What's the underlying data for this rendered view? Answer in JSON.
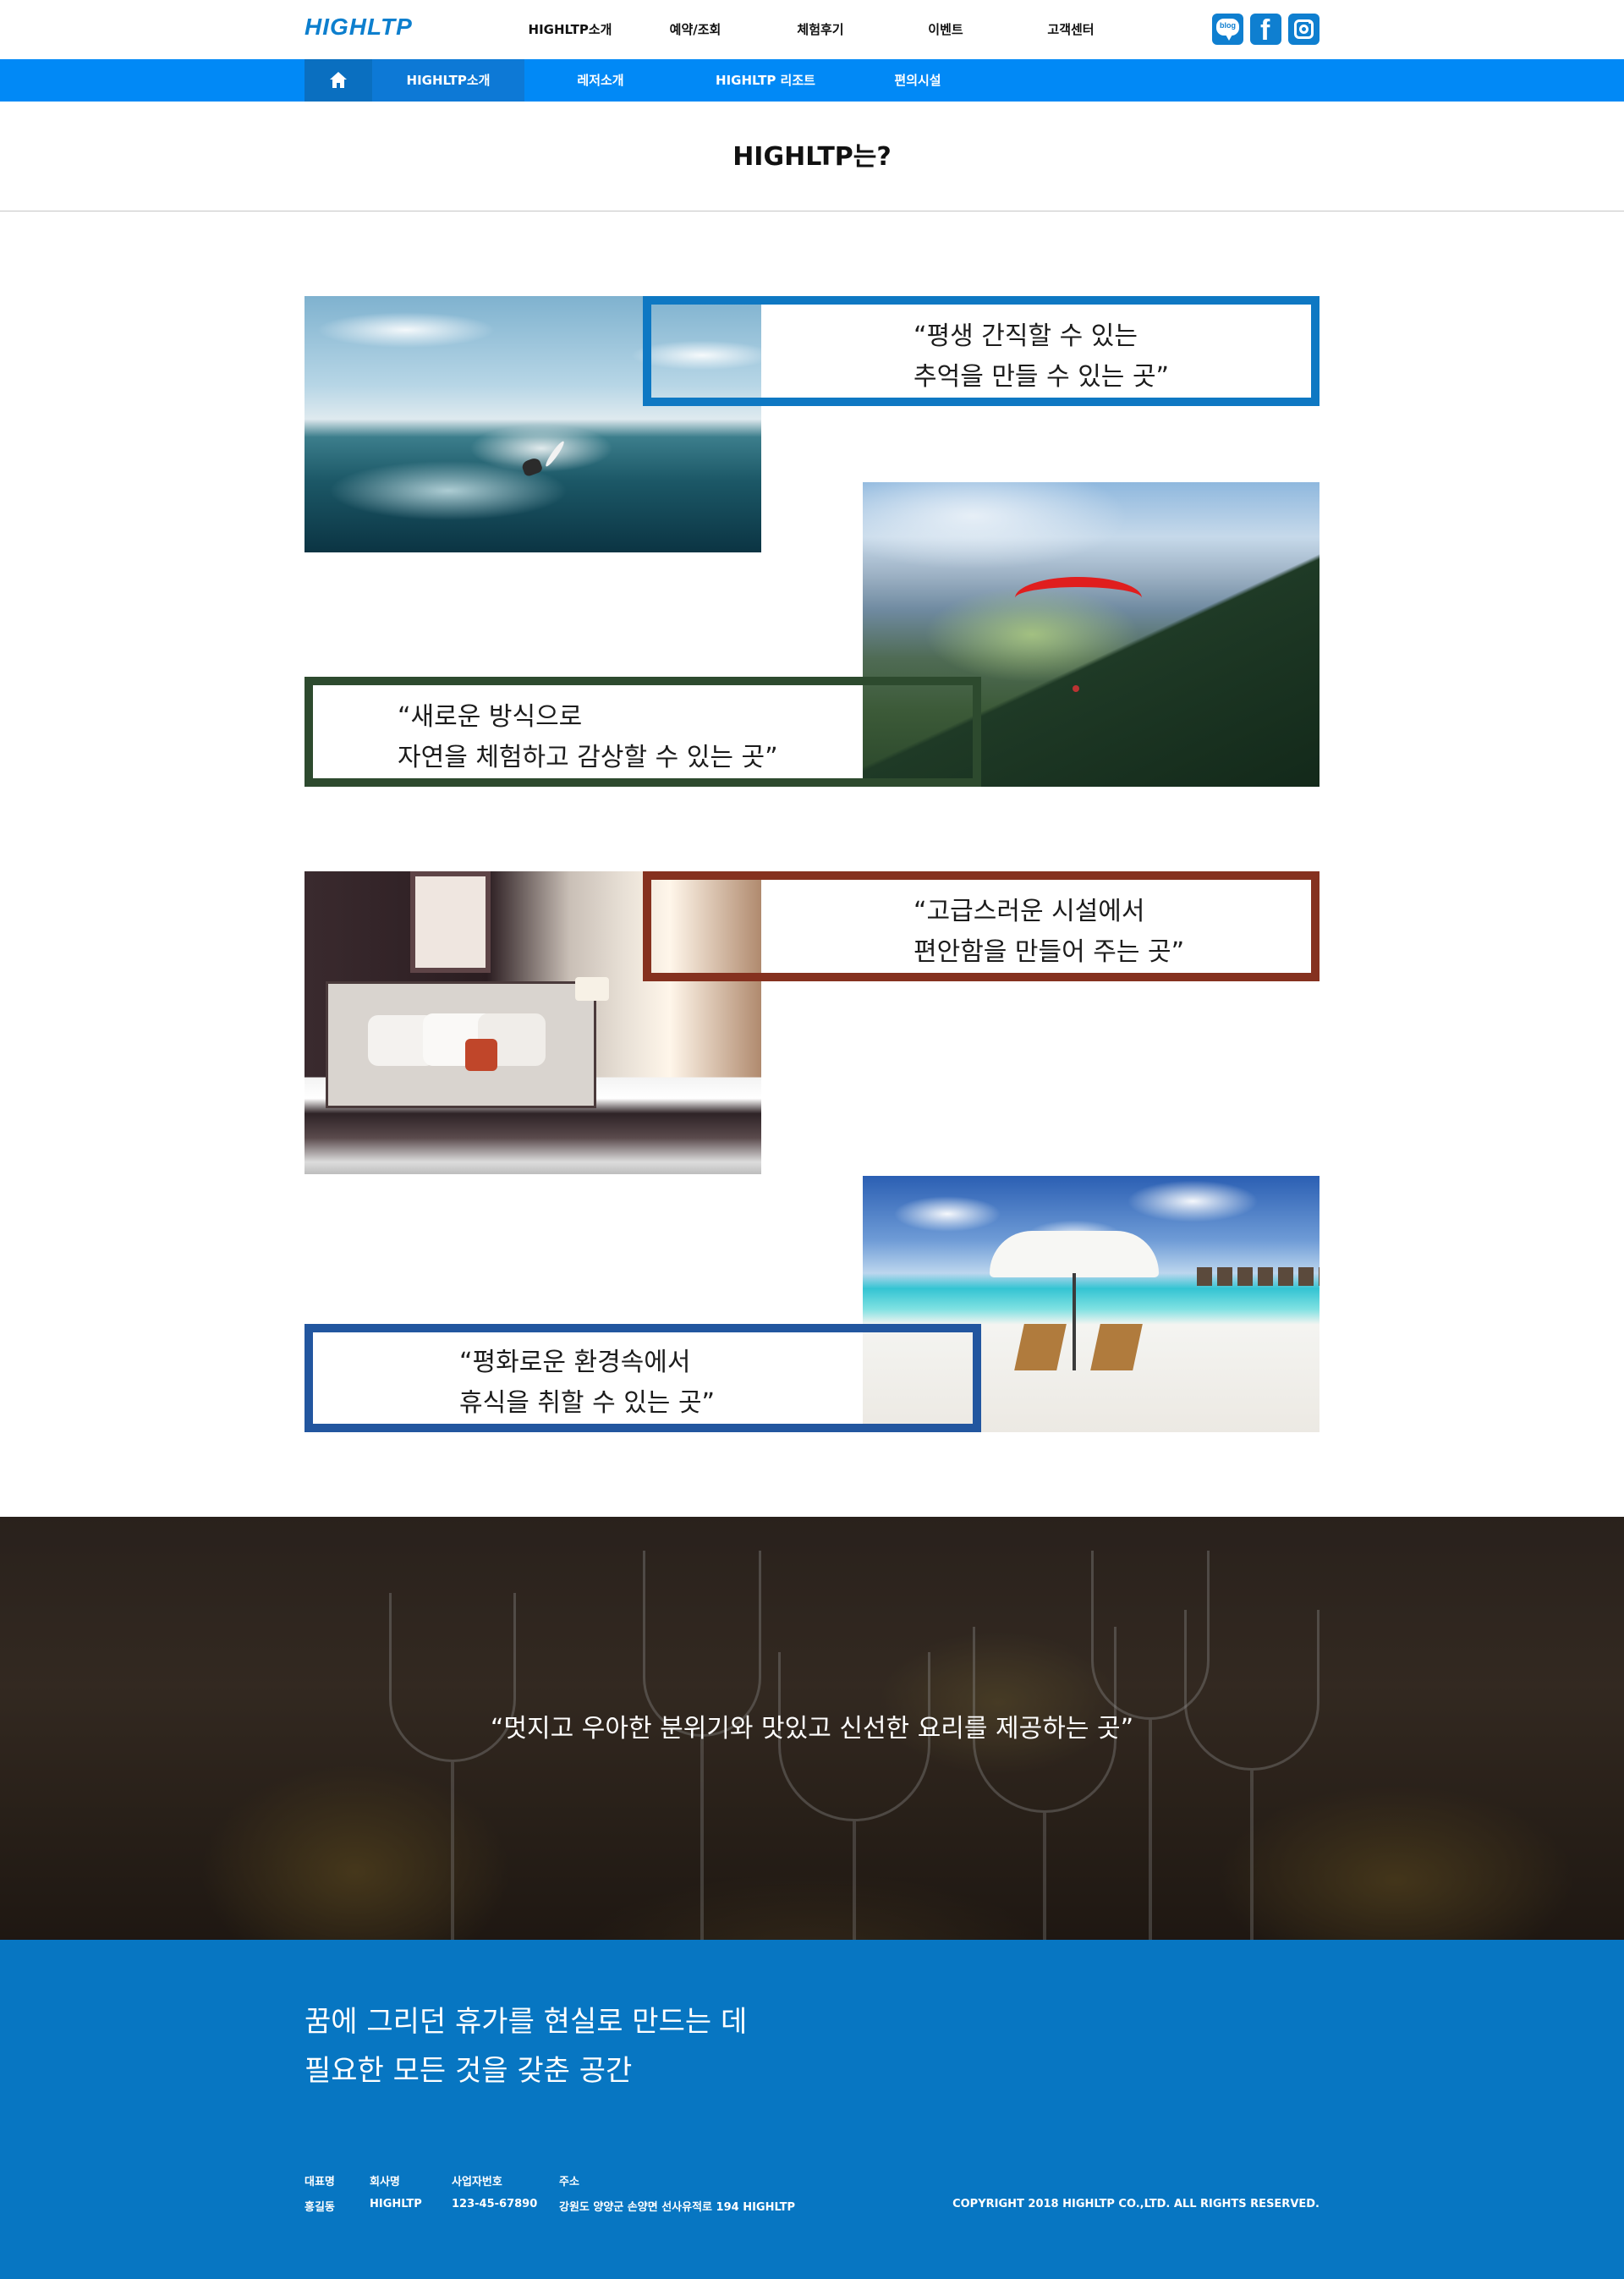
{
  "header": {
    "logo": "HIGHLTP",
    "nav": [
      "HIGHLTP소개",
      "예약/조회",
      "체험후기",
      "이벤트",
      "고객센터"
    ],
    "sns": {
      "blog_label": "blog",
      "facebook_label": "f"
    }
  },
  "subnav": {
    "items": [
      "HIGHLTP소개",
      "레저소개",
      "HIGHLTP 리조트",
      "편의시설"
    ]
  },
  "page_title": "HIGHLTP는?",
  "quotes": [
    {
      "line1": "“평생 간직할 수 있는",
      "line2": "추억을 만들 수 있는 곳”"
    },
    {
      "line1": "“새로운 방식으로",
      "line2": "자연을 체험하고 감상할 수 있는 곳”"
    },
    {
      "line1": "“고급스러운 시설에서",
      "line2": "편안함을 만들어 주는 곳”"
    },
    {
      "line1": "“평화로운 환경속에서",
      "line2": "휴식을 취할 수 있는 곳”"
    }
  ],
  "dining": {
    "text": "“멋지고 우아한 분위기와 맛있고 신선한 요리를 제공하는 곳”"
  },
  "footer": {
    "slogan_line1": "꿈에 그리던 휴가를 현실로 만드는 데",
    "slogan_line2": "필요한 모든 것을 갖춘 공간",
    "info": [
      {
        "label": "대표명",
        "value": "홍길동"
      },
      {
        "label": "회사명",
        "value": "HIGHLTP"
      },
      {
        "label": "사업자번호",
        "value": "123-45-67890"
      },
      {
        "label": "주소",
        "value": "강원도 양양군 손양면 선사유적로 194 HIGHLTP"
      }
    ],
    "copyright": "COPYRIGHT 2018 HIGHLTP CO.,LTD. ALL RIGHTS RESERVED."
  },
  "colors": {
    "brand_blue": "#0189f6",
    "footer_blue": "#0776c2",
    "quote1_border": "#0e78c3",
    "quote2_border": "#2d4a2e",
    "quote3_border": "#85311f",
    "quote4_border": "#22569f"
  }
}
